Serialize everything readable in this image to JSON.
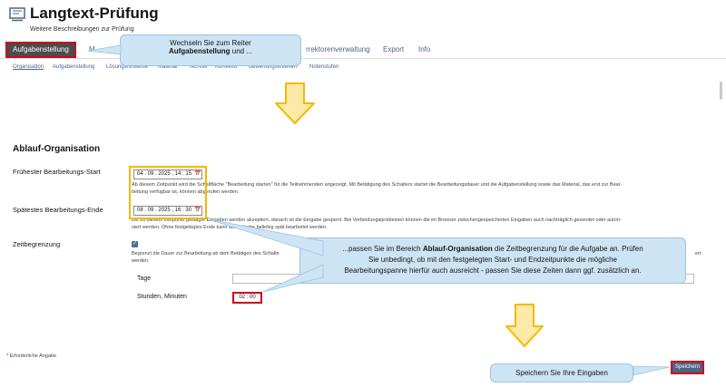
{
  "header": {
    "title": "Langtext-Prüfung",
    "subtitle": "Weitere Beschreibungen zur Prüfung",
    "icon": "test-icon"
  },
  "tabs": [
    {
      "label": "Aufgabenstellung",
      "active": true
    },
    {
      "label": "M"
    },
    {
      "label": "rrektorenverwaltung"
    },
    {
      "label": "Export"
    },
    {
      "label": "Info"
    }
  ],
  "subtabs": [
    {
      "label": "Organisation",
      "active": true
    },
    {
      "label": "Aufgabenstellung"
    },
    {
      "label": "Lösungshinweise"
    },
    {
      "label": "Material"
    },
    {
      "label": "Technik"
    },
    {
      "label": "Korrektur"
    },
    {
      "label": "Bewertungskriterien"
    },
    {
      "label": "Notenstufen"
    }
  ],
  "section": {
    "title": "Ablauf-Organisation",
    "start": {
      "label": "Frühester Bearbeitungs-Start",
      "value": "04 . 09 . 2025 ,  14 : 15",
      "help_line1": "Ab diesem Zeitpunkt wird die Schaltfläche \"Bearbeitung starten\" für die Teilnehmenden angezeigt. Mit Betätigung des Schalters startet die Bearbeitungsdauer und die Aufgabenstellung sowie das Material, das erst zur Bear-",
      "help_line2": "beitung verfügbar ist, können abgerufen werden."
    },
    "end": {
      "label": "Spätestes Bearbeitungs-Ende",
      "value": "08 . 09 . 2025 ,  16 : 30",
      "help_line1": "Bis zu diesem Zeitpunkt getätigte Eingaben werden akzeptiert, danach ist die Eingabe gesperrt. Bei Verbindungsproblemen können die im Browser zwischengespeicherten Eingaben auch nachträglich gesendet oder autori-",
      "help_line2": "siert werden. Ohne festgelegtes Ende kann die Aufgabe beliebig spät bearbeitet werden."
    },
    "limit": {
      "label": "Zeitbegrenzung",
      "checked": true,
      "help_line1": "Begrenzt die Dauer zur Bearbeitung ab dem Betätigen des Schalte",
      "help_line1_tail": "ert",
      "help_line2": "werden.",
      "days_label": "Tage",
      "days_value": "",
      "time_label": "Stunden, Minuten",
      "time_value": "02 : 00"
    }
  },
  "footer": {
    "required_star": "*",
    "required_text": "Erforderliche Angabe",
    "save_label": "Speichern"
  },
  "callouts": {
    "tab_line1": "Wechseln Sie zum Reiter",
    "tab_bold": "Aufgabenstellung",
    "tab_tail": "und ...",
    "org_pre": "...passen Sie im Bereich",
    "org_bold": "Ablauf-Organisation",
    "org_rest1": "die Zeitbegrenzung für die Aufgabe an. Prüfen",
    "org_line2": "Sie unbedingt, ob mit den festgelegten Start- und Endzeitpunkte die mögliche",
    "org_line3": "Bearbeitungspanne hierfür auch ausreicht - passen Sie diese Zeiten dann ggf. zusätzlich an.",
    "save_text": "Speichern Sie Ihre Eingaben"
  },
  "colors": {
    "accent_red": "#d0021b",
    "highlight_yellow": "#f5b800",
    "callout_blue": "#cde4f4",
    "arrow_fill": "#fde9a8",
    "tab_active": "#4c4c4c",
    "link_blue": "#4c6586"
  }
}
